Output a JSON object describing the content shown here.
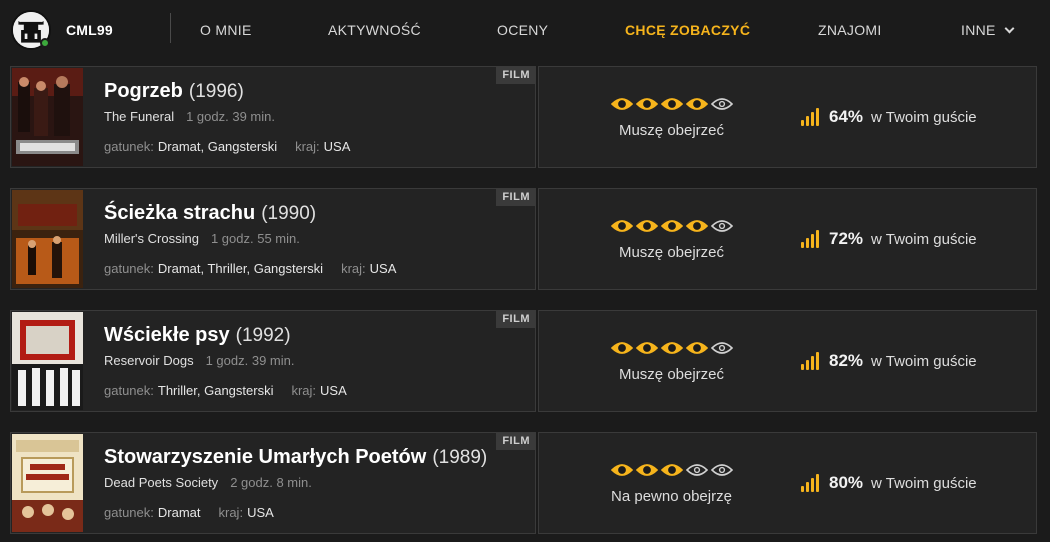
{
  "user": {
    "name": "CML99"
  },
  "nav": [
    {
      "label": "O MNIE"
    },
    {
      "label": "AKTYWNOŚĆ"
    },
    {
      "label": "OCENY"
    },
    {
      "label": "CHCĘ ZOBACZYĆ"
    },
    {
      "label": "ZNAJOMI"
    },
    {
      "label": "INNE"
    }
  ],
  "labels": {
    "badge": "FILM",
    "genre_key": "gatunek:",
    "country_key": "kraj:",
    "match_suffix": "w Twoim guście"
  },
  "colors": {
    "accent": "#f6b41c",
    "background": "#1b1b1b",
    "card": "#232323"
  },
  "movies": [
    {
      "title": "Pogrzeb",
      "year": "(1996)",
      "original": "The Funeral",
      "duration": "1 godz. 39 min.",
      "genres": "Dramat, Gangsterski",
      "country": "USA",
      "want_level": 4,
      "want_label": "Muszę obejrzeć",
      "match": "64%"
    },
    {
      "title": "Ścieżka strachu",
      "year": "(1990)",
      "original": "Miller's Crossing",
      "duration": "1 godz. 55 min.",
      "genres": "Dramat, Thriller, Gangsterski",
      "country": "USA",
      "want_level": 4,
      "want_label": "Muszę obejrzeć",
      "match": "72%"
    },
    {
      "title": "Wściekłe psy",
      "year": "(1992)",
      "original": "Reservoir Dogs",
      "duration": "1 godz. 39 min.",
      "genres": "Thriller, Gangsterski",
      "country": "USA",
      "want_level": 4,
      "want_label": "Muszę obejrzeć",
      "match": "82%"
    },
    {
      "title": "Stowarzyszenie Umarłych Poetów",
      "year": "(1989)",
      "original": "Dead Poets Society",
      "duration": "2 godz. 8 min.",
      "genres": "Dramat",
      "country": "USA",
      "want_level": 3,
      "want_label": "Na pewno obejrzę",
      "match": "80%"
    }
  ]
}
